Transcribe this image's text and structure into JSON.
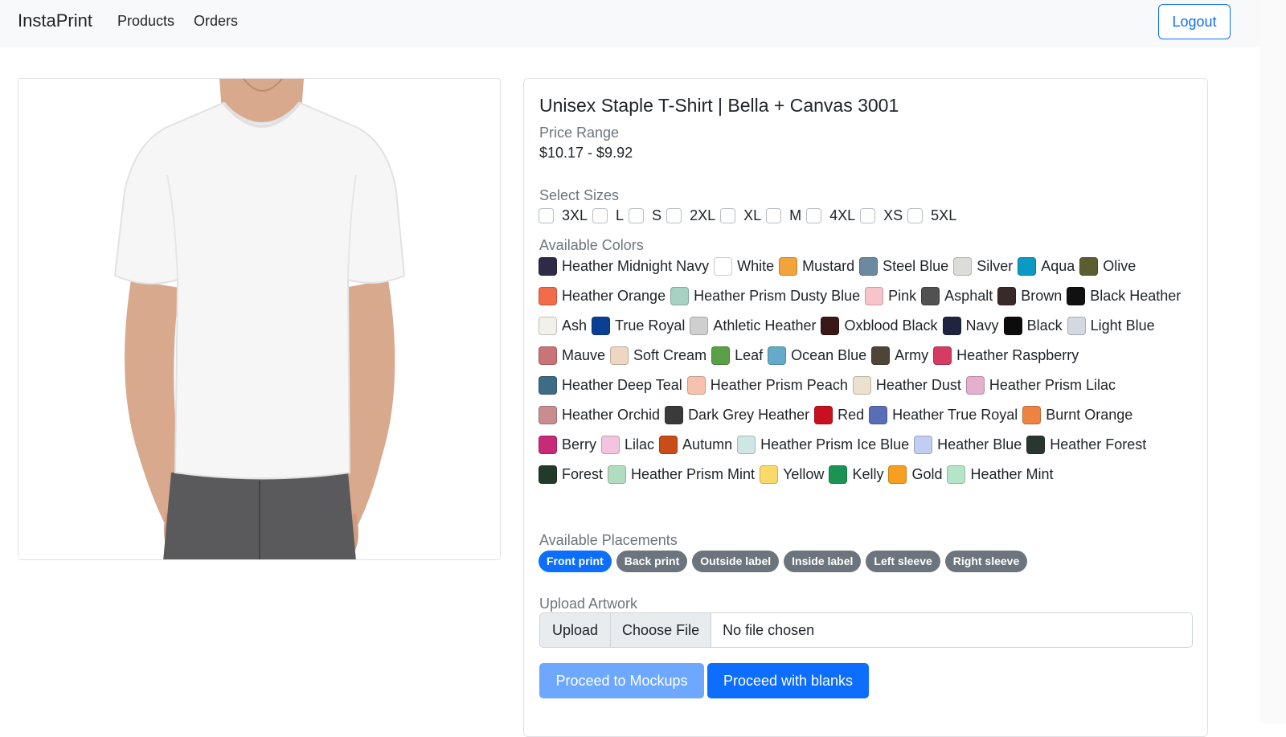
{
  "nav": {
    "brand": "InstaPrint",
    "links": [
      "Products",
      "Orders"
    ],
    "logout": "Logout"
  },
  "product": {
    "title": "Unisex Staple T-Shirt | Bella + Canvas 3001",
    "price_label": "Price Range",
    "price_value": "$10.17 - $9.92",
    "sizes_label": "Select Sizes",
    "sizes": [
      "3XL",
      "L",
      "S",
      "2XL",
      "XL",
      "M",
      "4XL",
      "XS",
      "5XL"
    ],
    "colors_label": "Available Colors",
    "colors": [
      {
        "name": "Heather Midnight Navy",
        "hex": "#2f2b47"
      },
      {
        "name": "White",
        "hex": "#ffffff"
      },
      {
        "name": "Mustard",
        "hex": "#f2a33a"
      },
      {
        "name": "Steel Blue",
        "hex": "#6b8aa0"
      },
      {
        "name": "Silver",
        "hex": "#dcdcd8"
      },
      {
        "name": "Aqua",
        "hex": "#0b9ac4"
      },
      {
        "name": "Olive",
        "hex": "#5a5e30"
      },
      {
        "name": "Heather Orange",
        "hex": "#f26c4a"
      },
      {
        "name": "Heather Prism Dusty Blue",
        "hex": "#a7d1c2"
      },
      {
        "name": "Pink",
        "hex": "#f8c4cc"
      },
      {
        "name": "Asphalt",
        "hex": "#515151"
      },
      {
        "name": "Brown",
        "hex": "#3a2a27"
      },
      {
        "name": "Black Heather",
        "hex": "#111111"
      },
      {
        "name": "Ash",
        "hex": "#f1f0ea"
      },
      {
        "name": "True Royal",
        "hex": "#0b3f94"
      },
      {
        "name": "Athletic Heather",
        "hex": "#cfcfcf"
      },
      {
        "name": "Oxblood Black",
        "hex": "#3a1719"
      },
      {
        "name": "Navy",
        "hex": "#1f2540"
      },
      {
        "name": "Black",
        "hex": "#0c0c0c"
      },
      {
        "name": "Light Blue",
        "hex": "#d3d8e2"
      },
      {
        "name": "Mauve",
        "hex": "#c97476"
      },
      {
        "name": "Soft Cream",
        "hex": "#edd7c0"
      },
      {
        "name": "Leaf",
        "hex": "#5aa047"
      },
      {
        "name": "Ocean Blue",
        "hex": "#64aac9"
      },
      {
        "name": "Army",
        "hex": "#4e4536"
      },
      {
        "name": "Heather Raspberry",
        "hex": "#d53b63"
      },
      {
        "name": "Heather Deep Teal",
        "hex": "#3c6c86"
      },
      {
        "name": "Heather Prism Peach",
        "hex": "#f6c2ae"
      },
      {
        "name": "Heather Dust",
        "hex": "#ece0cf"
      },
      {
        "name": "Heather Prism Lilac",
        "hex": "#e3b0cf"
      },
      {
        "name": "Heather Orchid",
        "hex": "#c98c8f"
      },
      {
        "name": "Dark Grey Heather",
        "hex": "#3a3a3a"
      },
      {
        "name": "Red",
        "hex": "#c8101f"
      },
      {
        "name": "Heather True Royal",
        "hex": "#5a6eb7"
      },
      {
        "name": "Burnt Orange",
        "hex": "#ee8341"
      },
      {
        "name": "Berry",
        "hex": "#c92a77"
      },
      {
        "name": "Lilac",
        "hex": "#f3c3df"
      },
      {
        "name": "Autumn",
        "hex": "#c94d16"
      },
      {
        "name": "Heather Prism Ice Blue",
        "hex": "#cfe7e4"
      },
      {
        "name": "Heather Blue",
        "hex": "#c1cdf1"
      },
      {
        "name": "Heather Forest",
        "hex": "#2a3630"
      },
      {
        "name": "Forest",
        "hex": "#213a2a"
      },
      {
        "name": "Heather Prism Mint",
        "hex": "#b2dcc0"
      },
      {
        "name": "Yellow",
        "hex": "#fbd968"
      },
      {
        "name": "Kelly",
        "hex": "#1a9452"
      },
      {
        "name": "Gold",
        "hex": "#f79f1f"
      },
      {
        "name": "Heather Mint",
        "hex": "#b4e5c9"
      }
    ],
    "placements_label": "Available Placements",
    "placements": [
      {
        "label": "Front print",
        "active": true
      },
      {
        "label": "Back print",
        "active": false
      },
      {
        "label": "Outside label",
        "active": false
      },
      {
        "label": "Inside label",
        "active": false
      },
      {
        "label": "Left sleeve",
        "active": false
      },
      {
        "label": "Right sleeve",
        "active": false
      }
    ],
    "upload_label": "Upload Artwork",
    "upload_prefix": "Upload",
    "choose_file": "Choose File",
    "file_status": "No file chosen",
    "proceed_mockups": "Proceed to Mockups",
    "proceed_blanks": "Proceed with blanks"
  },
  "accent": "#0d6efd"
}
